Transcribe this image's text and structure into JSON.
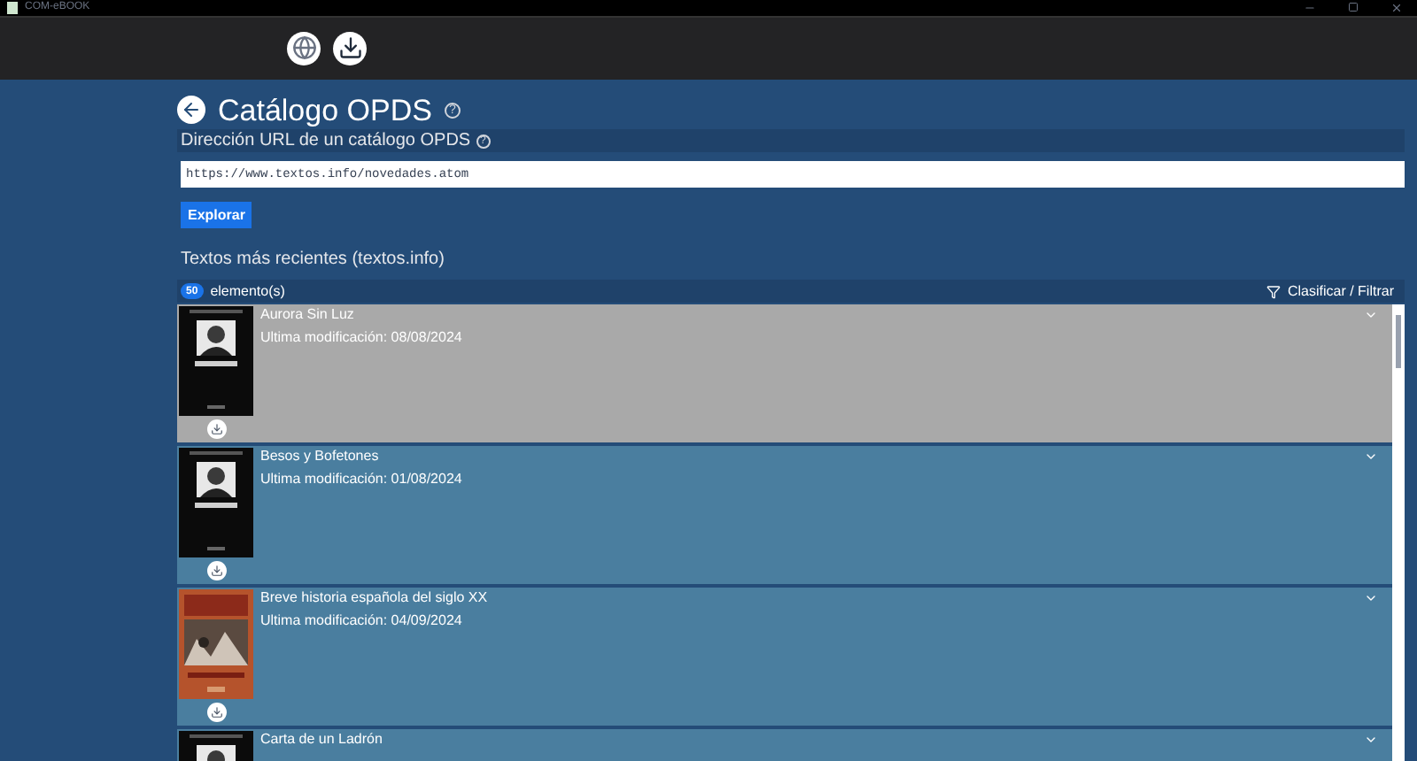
{
  "window": {
    "title": "COM-eBOOK"
  },
  "toolbar": {
    "buttons": [
      {
        "kind": "globe"
      },
      {
        "kind": "download"
      }
    ]
  },
  "page": {
    "title": "Catálogo OPDS",
    "help": "?"
  },
  "url_section": {
    "label": "Dirección URL de un catálogo OPDS",
    "help": "?",
    "value": "https://www.textos.info/novedades.atom",
    "button": "Explorar"
  },
  "catalog": {
    "title": "Textos más recientes (textos.info)",
    "count": "50",
    "count_label": "elemento(s)",
    "filter_label": "Clasificar / Filtrar",
    "items": [
      {
        "title": "Aurora Sin Luz",
        "modified": "Ultima modificación: 08/08/2024",
        "selected": true,
        "kind": "portrait"
      },
      {
        "title": "Besos y Bofetones",
        "modified": "Ultima modificación: 01/08/2024",
        "selected": false,
        "kind": "portrait"
      },
      {
        "title": "Breve historia española del siglo XX",
        "modified": "Ultima modificación: 04/09/2024",
        "selected": false,
        "kind": "red"
      },
      {
        "title": "Carta de un Ladrón",
        "selected": false,
        "kind": "portrait"
      }
    ]
  }
}
